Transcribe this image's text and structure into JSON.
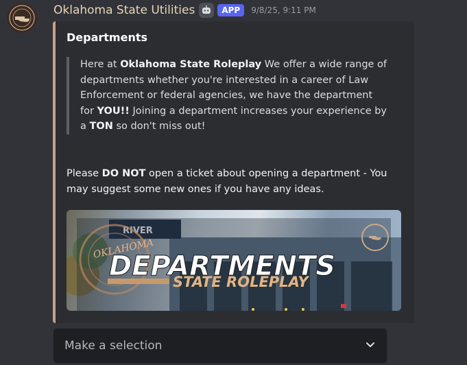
{
  "message": {
    "author": "Oklahoma State Utilities",
    "badge": "APP",
    "timestamp": "9/8/25, 9:11 PM"
  },
  "embed": {
    "accent_color": "#caa085",
    "title": "Departments",
    "quote": {
      "t1": "Here at ",
      "b1": "Oklahoma State Roleplay",
      "t2": " We offer a wide range of departments whether you're interested in a career of Law Enforcement or federal agencies, we have the department for ",
      "b2": "YOU!!",
      "t3": " Joining a department increases your experience by a ",
      "b3": "TON",
      "t4": " so don't miss out!"
    },
    "notice": {
      "t1": "Please ",
      "b1": "DO NOT",
      "t2": " open a ticket about opening a department - You may suggest some new ones if you have any ideas."
    },
    "banner": {
      "logo_text": "OKLAHOMA",
      "sign_text": "RIVER",
      "headline": "DEPARTMENTS",
      "subline": "STATE ROLEPLAY"
    }
  },
  "select_menu": {
    "placeholder": "Make a selection",
    "icon": "chevron-down-icon"
  },
  "colors": {
    "app_badge": "#5865f2",
    "background": "#323339",
    "embed_bg": "#2b2d31",
    "username": "#e6d7b3"
  }
}
